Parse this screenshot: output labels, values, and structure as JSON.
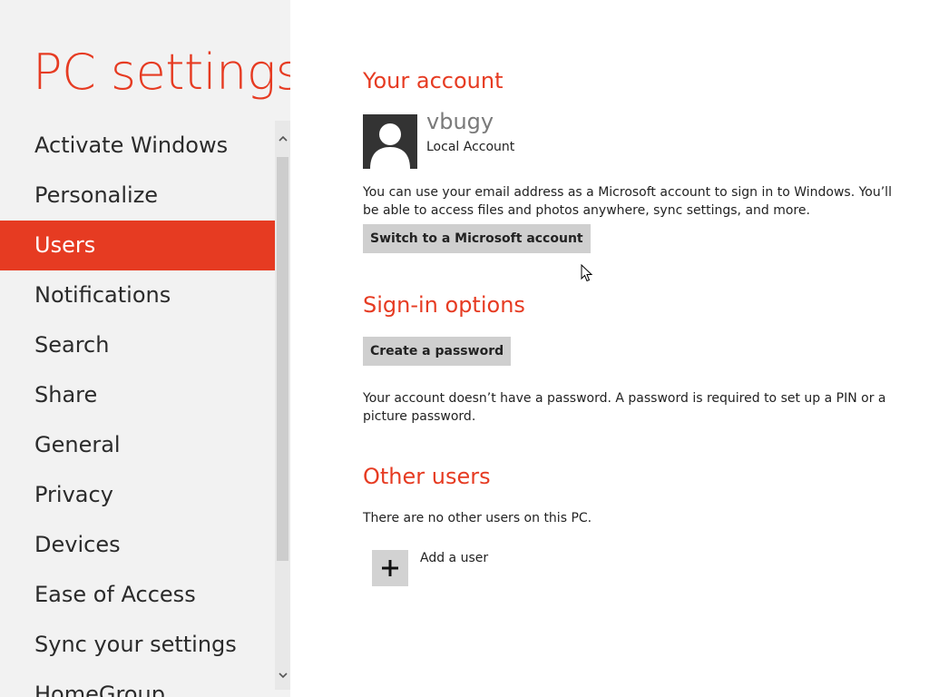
{
  "app": {
    "title": "PC settings"
  },
  "nav": {
    "items": [
      {
        "label": "Activate Windows",
        "selected": false
      },
      {
        "label": "Personalize",
        "selected": false
      },
      {
        "label": "Users",
        "selected": true
      },
      {
        "label": "Notifications",
        "selected": false
      },
      {
        "label": "Search",
        "selected": false
      },
      {
        "label": "Share",
        "selected": false
      },
      {
        "label": "General",
        "selected": false
      },
      {
        "label": "Privacy",
        "selected": false
      },
      {
        "label": "Devices",
        "selected": false
      },
      {
        "label": "Ease of Access",
        "selected": false
      },
      {
        "label": "Sync your settings",
        "selected": false
      },
      {
        "label": "HomeGroup",
        "selected": false
      }
    ]
  },
  "account": {
    "heading": "Your account",
    "user_name": "vbugy",
    "user_type": "Local Account",
    "description": "You can use your email address as a Microsoft account to sign in to Windows. You’ll be able to access files and photos anywhere, sync settings, and more.",
    "switch_button": "Switch to a Microsoft account"
  },
  "signin": {
    "heading": "Sign-in options",
    "create_password_button": "Create a password",
    "note": "Your account doesn’t have a password. A password is required to set up a PIN or a picture password."
  },
  "other_users": {
    "heading": "Other users",
    "note": "There are no other users on this PC.",
    "add_user_label": "Add a user"
  },
  "colors": {
    "accent": "#e63b22",
    "nav_background": "#f2f2f2",
    "button_background": "#cfcfcf"
  }
}
